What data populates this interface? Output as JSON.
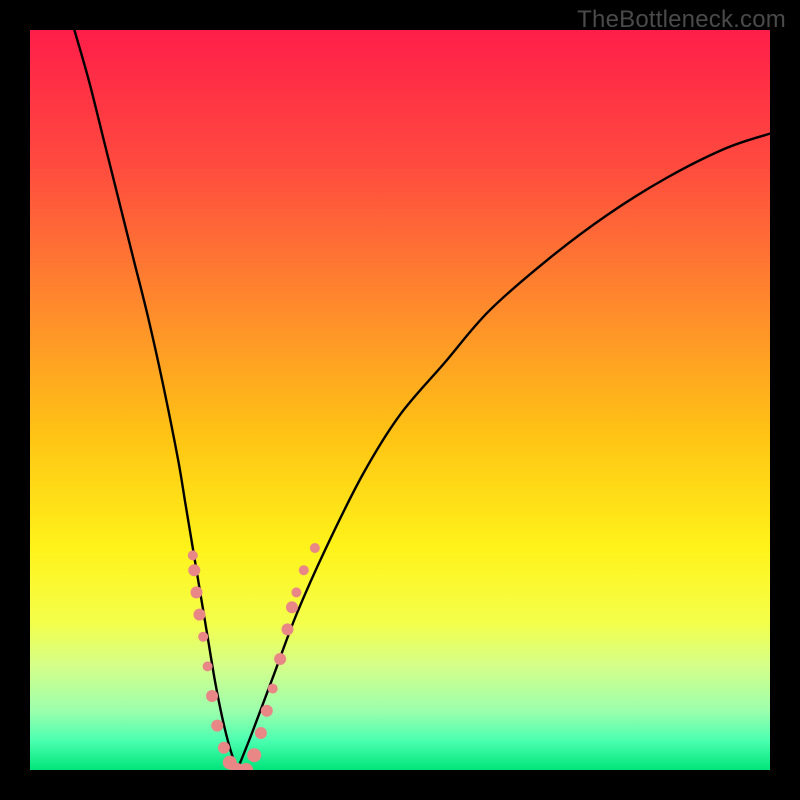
{
  "watermark": "TheBottleneck.com",
  "chart_data": {
    "type": "line",
    "title": "",
    "xlabel": "",
    "ylabel": "",
    "xlim": [
      0,
      100
    ],
    "ylim": [
      0,
      100
    ],
    "grid": false,
    "background": {
      "type": "vertical-gradient",
      "stops": [
        {
          "offset": 0.0,
          "color": "#ff1e49"
        },
        {
          "offset": 0.18,
          "color": "#ff4a3f"
        },
        {
          "offset": 0.38,
          "color": "#ff8c2c"
        },
        {
          "offset": 0.55,
          "color": "#ffc414"
        },
        {
          "offset": 0.7,
          "color": "#fff31a"
        },
        {
          "offset": 0.8,
          "color": "#f4ff4a"
        },
        {
          "offset": 0.86,
          "color": "#d4ff8a"
        },
        {
          "offset": 0.92,
          "color": "#9cffad"
        },
        {
          "offset": 0.96,
          "color": "#4bffb0"
        },
        {
          "offset": 1.0,
          "color": "#00e57a"
        }
      ]
    },
    "series": [
      {
        "name": "left-branch",
        "x": [
          6,
          8,
          10,
          12,
          14,
          16,
          18,
          20,
          21,
          22,
          23,
          24,
          25,
          26,
          27,
          28
        ],
        "y": [
          100,
          93,
          85,
          77,
          69,
          61,
          52,
          42,
          36,
          30,
          24,
          18,
          12,
          7,
          3,
          0
        ]
      },
      {
        "name": "right-branch",
        "x": [
          28,
          30,
          33,
          36,
          40,
          45,
          50,
          56,
          62,
          70,
          78,
          86,
          94,
          100
        ],
        "y": [
          0,
          5,
          13,
          21,
          30,
          40,
          48,
          55,
          62,
          69,
          75,
          80,
          84,
          86
        ]
      }
    ],
    "scatter_points": {
      "name": "highlighted-points",
      "color": "#e98787",
      "points": [
        {
          "x": 22.0,
          "y": 29,
          "r": 5
        },
        {
          "x": 22.2,
          "y": 27,
          "r": 6
        },
        {
          "x": 22.5,
          "y": 24,
          "r": 6
        },
        {
          "x": 22.9,
          "y": 21,
          "r": 6
        },
        {
          "x": 23.4,
          "y": 18,
          "r": 5
        },
        {
          "x": 24.0,
          "y": 14,
          "r": 5
        },
        {
          "x": 24.6,
          "y": 10,
          "r": 6
        },
        {
          "x": 25.3,
          "y": 6,
          "r": 6
        },
        {
          "x": 26.2,
          "y": 3,
          "r": 6
        },
        {
          "x": 27.0,
          "y": 1,
          "r": 7
        },
        {
          "x": 28.0,
          "y": 0,
          "r": 7
        },
        {
          "x": 29.2,
          "y": 0,
          "r": 7
        },
        {
          "x": 30.3,
          "y": 2,
          "r": 7
        },
        {
          "x": 31.2,
          "y": 5,
          "r": 6
        },
        {
          "x": 32.0,
          "y": 8,
          "r": 6
        },
        {
          "x": 32.8,
          "y": 11,
          "r": 5
        },
        {
          "x": 33.8,
          "y": 15,
          "r": 6
        },
        {
          "x": 34.8,
          "y": 19,
          "r": 6
        },
        {
          "x": 35.4,
          "y": 22,
          "r": 6
        },
        {
          "x": 36.0,
          "y": 24,
          "r": 5
        },
        {
          "x": 37.0,
          "y": 27,
          "r": 5
        },
        {
          "x": 38.5,
          "y": 30,
          "r": 5
        }
      ]
    }
  }
}
